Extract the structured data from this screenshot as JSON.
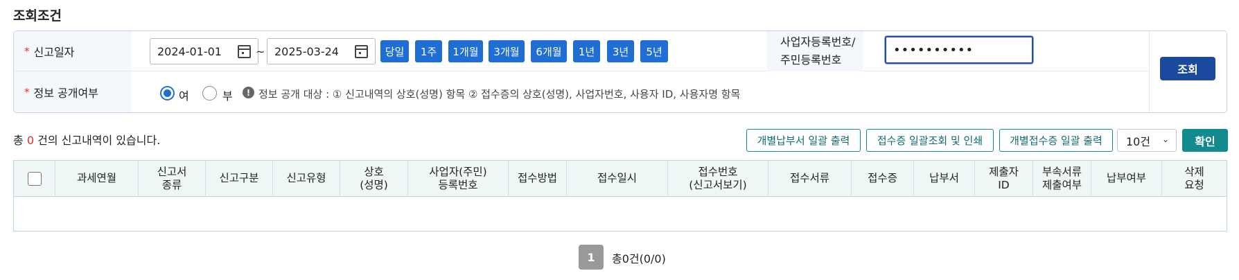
{
  "section_title": "조회조건",
  "search": {
    "report_date_label": "신고일자",
    "required_mark": "*",
    "date_from": "2024-01-01",
    "date_to": "2025-03-24",
    "tilde": "~",
    "periods": [
      "당일",
      "1주",
      "1개월",
      "3개월",
      "6개월",
      "1년",
      "3년",
      "5년"
    ],
    "bizno_label_line1": "사업자등록번호/",
    "bizno_label_line2": "주민등록번호",
    "bizno_value": "••••••••••",
    "search_button": "조회",
    "disclosure_label": "정보 공개여부",
    "radio_yes": "여",
    "radio_no": "부",
    "info_mark": "!",
    "info_text": "정보 공개 대상 : ① 신고내역의 상호(성명) 항목 ② 접수증의 상호(성명), 사업자번호, 사용자 ID, 사용자명 항목"
  },
  "summary": {
    "prefix": "총",
    "count": "0",
    "suffix": "건의 신고내역이 있습니다."
  },
  "actions": {
    "btn1": "개별납부서 일괄 출력",
    "btn2": "접수증 일괄조회 및 인쇄",
    "btn3": "개별접수증 일괄 출력",
    "page_size": "10건",
    "confirm": "확인"
  },
  "table": {
    "headers": [
      "과세연월",
      "신고서\n종류",
      "신고구분",
      "신고유형",
      "상호\n(성명)",
      "사업자(주민)\n등록번호",
      "접수방법",
      "접수일시",
      "접수번호\n(신고서보기)",
      "접수서류",
      "접수증",
      "납부서",
      "제출자\nID",
      "부속서류\n제출여부",
      "납부여부",
      "삭제\n요청"
    ]
  },
  "pagination": {
    "current_page": "1",
    "total_text": "총0건(0/0)"
  },
  "colors": {
    "primary_blue": "#1f6ed4",
    "search_button": "#1b4a9c",
    "teal": "#138a8e",
    "required_red": "#e0302f"
  }
}
